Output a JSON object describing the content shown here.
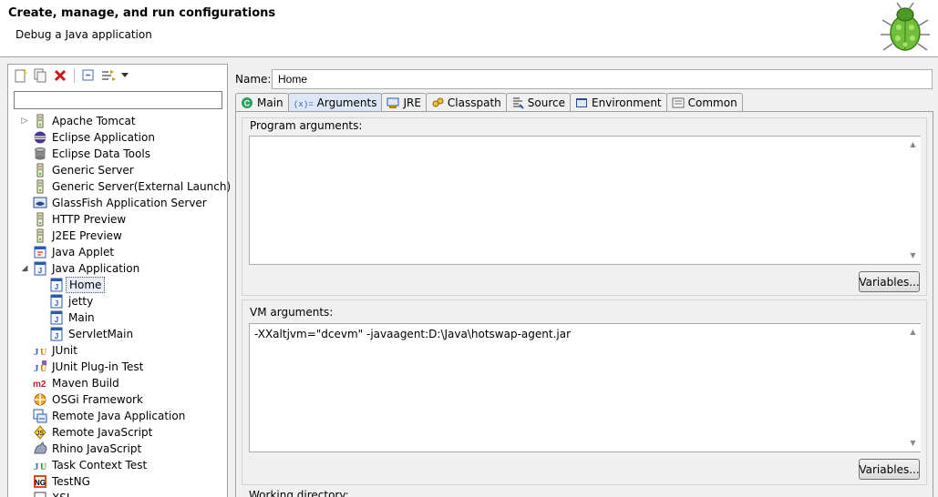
{
  "banner": {
    "title": "Create, manage, and run configurations",
    "subtitle": "Debug a Java application",
    "icon": "debug-bug-icon"
  },
  "left_toolbar": {
    "buttons": [
      "new-config-icon",
      "duplicate-config-icon",
      "delete-config-icon",
      "collapse-all-icon",
      "filter-icon",
      "dropdown-chevron-icon"
    ]
  },
  "filter": {
    "value": ""
  },
  "tree": {
    "items": [
      {
        "label": "Apache Tomcat",
        "icon": "server-icon"
      },
      {
        "label": "Eclipse Application",
        "icon": "eclipse-icon"
      },
      {
        "label": "Eclipse Data Tools",
        "icon": "database-icon"
      },
      {
        "label": "Generic Server",
        "icon": "server-icon"
      },
      {
        "label": "Generic Server(External Launch)",
        "icon": "server-icon"
      },
      {
        "label": "GlassFish Application Server",
        "icon": "glassfish-icon"
      },
      {
        "label": "HTTP Preview",
        "icon": "server-icon"
      },
      {
        "label": "J2EE Preview",
        "icon": "server-icon"
      },
      {
        "label": "Java Applet",
        "icon": "applet-icon"
      },
      {
        "label": "Java Application",
        "icon": "java-app-icon"
      },
      {
        "label": "Home",
        "icon": "java-app-icon"
      },
      {
        "label": "jetty",
        "icon": "java-app-icon"
      },
      {
        "label": "Main",
        "icon": "java-app-icon"
      },
      {
        "label": "ServletMain",
        "icon": "java-app-icon"
      },
      {
        "label": "JUnit",
        "icon": "junit-icon"
      },
      {
        "label": "JUnit Plug-in Test",
        "icon": "junit-plugin-icon"
      },
      {
        "label": "Maven Build",
        "icon": "maven-icon"
      },
      {
        "label": "OSGi Framework",
        "icon": "osgi-icon"
      },
      {
        "label": "Remote Java Application",
        "icon": "remote-java-icon"
      },
      {
        "label": "Remote JavaScript",
        "icon": "remote-javascript-icon"
      },
      {
        "label": "Rhino JavaScript",
        "icon": "rhino-icon"
      },
      {
        "label": "Task Context Test",
        "icon": "task-context-icon"
      },
      {
        "label": "TestNG",
        "icon": "testng-icon"
      },
      {
        "label": "XSL",
        "icon": "xsl-icon"
      }
    ]
  },
  "form": {
    "name_label": "Name:",
    "name_value": "Home"
  },
  "tabs": [
    {
      "label": "Main",
      "icon": "main-tab-icon"
    },
    {
      "label": "Arguments",
      "icon": "arguments-tab-icon",
      "active": true
    },
    {
      "label": "JRE",
      "icon": "jre-tab-icon"
    },
    {
      "label": "Classpath",
      "icon": "classpath-tab-icon"
    },
    {
      "label": "Source",
      "icon": "source-tab-icon"
    },
    {
      "label": "Environment",
      "icon": "environment-tab-icon"
    },
    {
      "label": "Common",
      "icon": "common-tab-icon"
    }
  ],
  "arguments": {
    "program_label": "Program arguments:",
    "program_value": "",
    "program_variables": "Variables...",
    "vm_label": "VM arguments:",
    "vm_value": "-XXaltjvm=\"dcevm\" -javaagent:D:\\Java\\hotswap-agent.jar",
    "vm_variables": "Variables...",
    "workdir_label": "Working directory:"
  }
}
